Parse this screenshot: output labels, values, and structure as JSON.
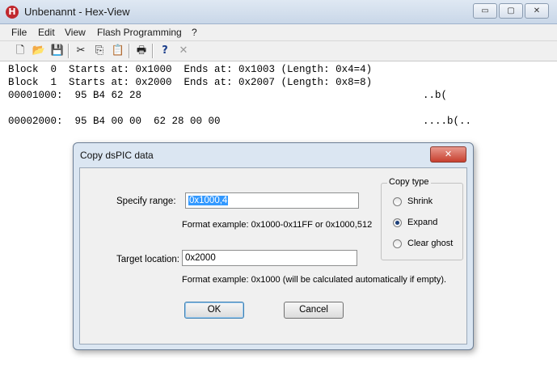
{
  "window": {
    "title": "Unbenannt - Hex-View",
    "app_icon": "H"
  },
  "caption": {
    "minimize": "▭",
    "maximize": "▢",
    "close": "✕"
  },
  "menu": [
    "File",
    "Edit",
    "View",
    "Flash Programming",
    "?"
  ],
  "toolbar": {
    "icons": [
      "new-file-icon",
      "open-folder-icon",
      "save-icon",
      "cut-icon",
      "copy-icon",
      "paste-icon",
      "print-icon",
      "help-icon",
      "delete-icon"
    ],
    "glyphs": {
      "new": "🗋",
      "open": "📂",
      "save": "💾",
      "cut": "✂",
      "copy": "⎘",
      "paste": "📋",
      "print": "🖶",
      "help": "?",
      "delete": "✕"
    }
  },
  "hex": {
    "lines": [
      "Block  0  Starts at: 0x1000  Ends at: 0x1003 (Length: 0x4=4)",
      "Block  1  Starts at: 0x2000  Ends at: 0x2007 (Length: 0x8=8)",
      "00001000:  95 B4 62 28",
      "00002000:  95 B4 00 00  62 28 00 00"
    ],
    "ascii": [
      "..b(",
      "....b(.."
    ]
  },
  "dialog": {
    "title": "Copy dsPIC data",
    "close": "✕",
    "range_label": "Specify range:",
    "range_value": "0x1000,4",
    "range_hint": "Format example: 0x1000-0x11FF or 0x1000,512",
    "target_label": "Target location:",
    "target_value": "0x2000",
    "target_hint": "Format example: 0x1000 (will be calculated automatically if empty).",
    "copy_type": {
      "title": "Copy type",
      "options": [
        "Shrink",
        "Expand",
        "Clear ghost"
      ],
      "selected": "Expand"
    },
    "ok": "OK",
    "cancel": "Cancel"
  },
  "colors": {
    "selection": "#3399ff",
    "dialog_frame": "#dbe6f2",
    "close_red": "#c7402f"
  }
}
